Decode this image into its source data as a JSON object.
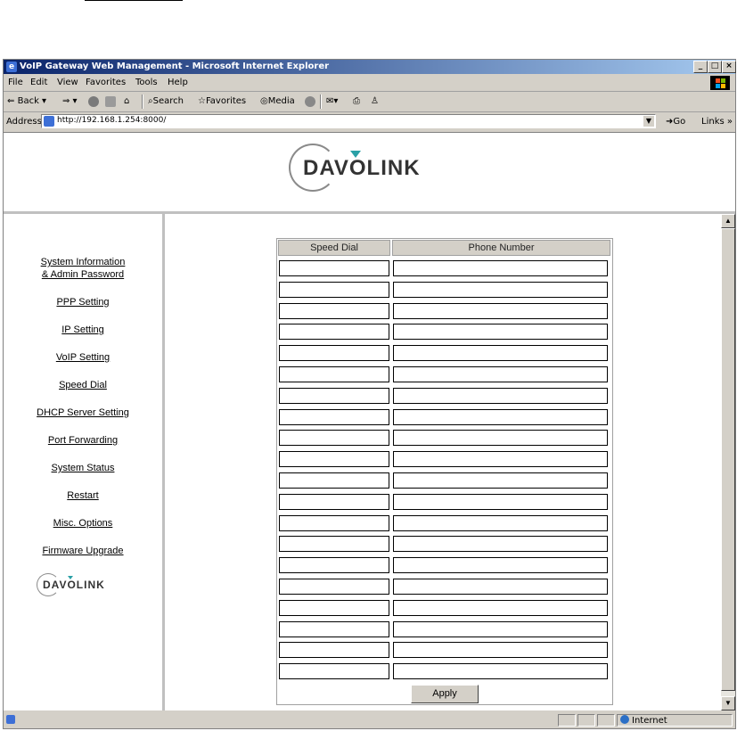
{
  "browser": {
    "title": "VoIP Gateway Web Management - Microsoft Internet Explorer",
    "menu": [
      "File",
      "Edit",
      "View",
      "Favorites",
      "Tools",
      "Help"
    ],
    "toolbar": {
      "back": "Back",
      "search": "Search",
      "favorites": "Favorites",
      "media": "Media"
    },
    "address_label": "Address",
    "address": "http://192.168.1.254:8000/",
    "go": "Go",
    "links": "Links »",
    "status_zone": "Internet"
  },
  "logo": {
    "brand": "DAVOLINK"
  },
  "nav": {
    "items": [
      "System Information",
      "& Admin Password",
      "PPP Setting",
      "IP Setting",
      "VoIP Setting",
      "Speed Dial",
      "DHCP Server Setting",
      "Port Forwarding",
      "System Status",
      "Restart",
      "Misc. Options",
      "Firmware Upgrade"
    ]
  },
  "speed_dial": {
    "headers": [
      "Speed Dial",
      "Phone Number"
    ],
    "row_count": 20,
    "apply_label": "Apply"
  }
}
